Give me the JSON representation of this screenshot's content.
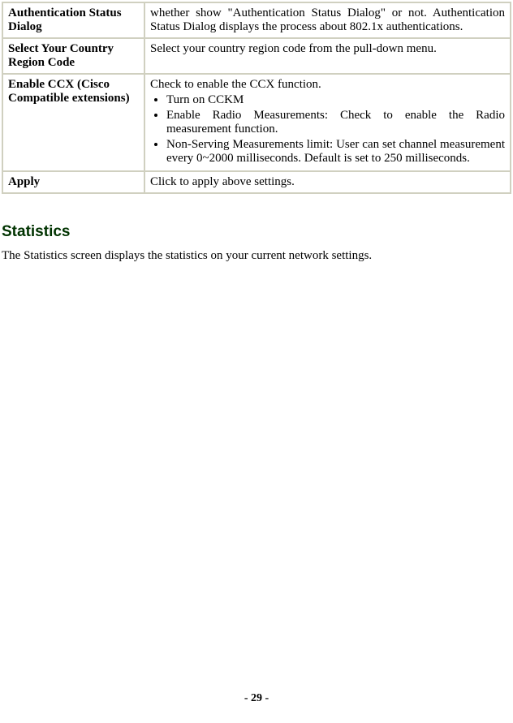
{
  "table": {
    "rows": [
      {
        "label": "Authentication Status Dialog",
        "desc": "whether show \"Authentication Status Dialog\" or not. Authentication Status Dialog displays the process about 802.1x authentications."
      },
      {
        "label": "Select Your Country Region Code",
        "desc": "Select your country region code from the pull-down menu."
      },
      {
        "label": "Enable CCX (Cisco Compatible extensions)",
        "desc_intro": "Check to enable the CCX function.",
        "bullets": [
          "Turn on CCKM",
          "Enable Radio Measurements: Check to enable the Radio measurement function.",
          "Non-Serving Measurements limit: User can set channel measurement every 0~2000 milliseconds. Default is set to 250 milliseconds."
        ]
      },
      {
        "label": "Apply",
        "desc": "Click to apply above settings."
      }
    ]
  },
  "section": {
    "heading": "Statistics",
    "body": "The Statistics screen displays the statistics on your current network settings."
  },
  "page_number": "- 29 -"
}
